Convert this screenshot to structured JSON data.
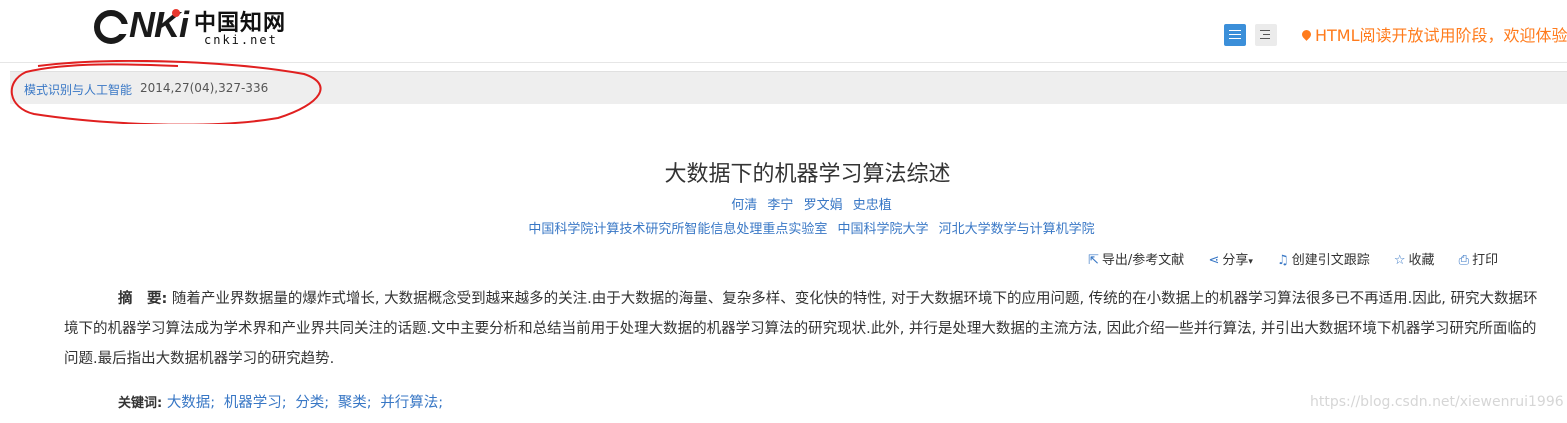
{
  "header": {
    "logo_text": "CNKi",
    "logo_cn": "中国知网",
    "logo_domain": "cnki.net",
    "notice": "HTML阅读开放试用阶段，欢迎体验",
    "view_buttons": [
      "list-view",
      "outline-view"
    ]
  },
  "infobar": {
    "journal": "模式识别与人工智能",
    "issue": "2014,27(04),327-336"
  },
  "article": {
    "title": "大数据下的机器学习算法综述",
    "authors": [
      "何清",
      "李宁",
      "罗文娟",
      "史忠植"
    ],
    "affiliations": [
      "中国科学院计算技术研究所智能信息处理重点实验室",
      "中国科学院大学",
      "河北大学数学与计算机学院"
    ]
  },
  "toolbar": {
    "export": "导出/参考文献",
    "share": "分享",
    "track": "创建引文跟踪",
    "favorite": "收藏",
    "print": "打印"
  },
  "abstract": {
    "label": "摘　要:",
    "text": "随着产业界数据量的爆炸式增长, 大数据概念受到越来越多的关注.由于大数据的海量、复杂多样、变化快的特性, 对于大数据环境下的应用问题, 传统的在小数据上的机器学习算法很多已不再适用.因此, 研究大数据环境下的机器学习算法成为学术界和产业界共同关注的话题.文中主要分析和总结当前用于处理大数据的机器学习算法的研究现状.此外, 并行是处理大数据的主流方法, 因此介绍一些并行算法, 并引出大数据环境下机器学习研究所面临的问题.最后指出大数据机器学习的研究趋势."
  },
  "keywords": {
    "label": "关键词:",
    "items": [
      "大数据;",
      "机器学习;",
      "分类;",
      "聚类;",
      "并行算法;"
    ]
  },
  "watermark": "https://blog.csdn.net/xiewenrui1996",
  "colors": {
    "link": "#3877c5",
    "notice": "#ff7b1c",
    "active_button": "#3b8fd9",
    "annotation": "#e02020"
  }
}
